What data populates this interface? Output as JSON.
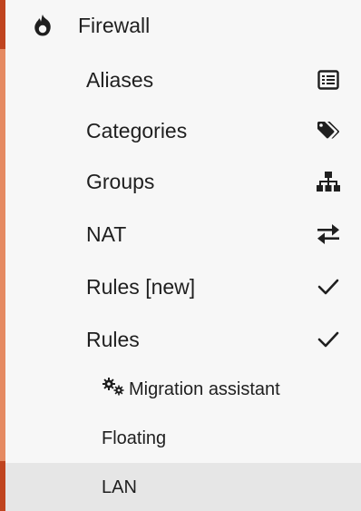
{
  "menu": {
    "header": {
      "label": "Firewall",
      "icon": "flame-icon"
    },
    "items": [
      {
        "label": "Aliases",
        "icon": "list-icon"
      },
      {
        "label": "Categories",
        "icon": "tag-icon"
      },
      {
        "label": "Groups",
        "icon": "sitemap-icon"
      },
      {
        "label": "NAT",
        "icon": "exchange-icon"
      },
      {
        "label": "Rules [new]",
        "icon": "check-icon"
      },
      {
        "label": "Rules",
        "icon": "check-icon"
      }
    ],
    "sub_items": [
      {
        "label": "Migration assistant",
        "icon": "cogs-icon"
      },
      {
        "label": "Floating"
      },
      {
        "label": "LAN",
        "active": true
      }
    ]
  },
  "colors": {
    "accent": "#e58a62",
    "accent_dark": "#c0441f",
    "active_bg": "#e6e6e6",
    "text": "#1f1f1f"
  }
}
